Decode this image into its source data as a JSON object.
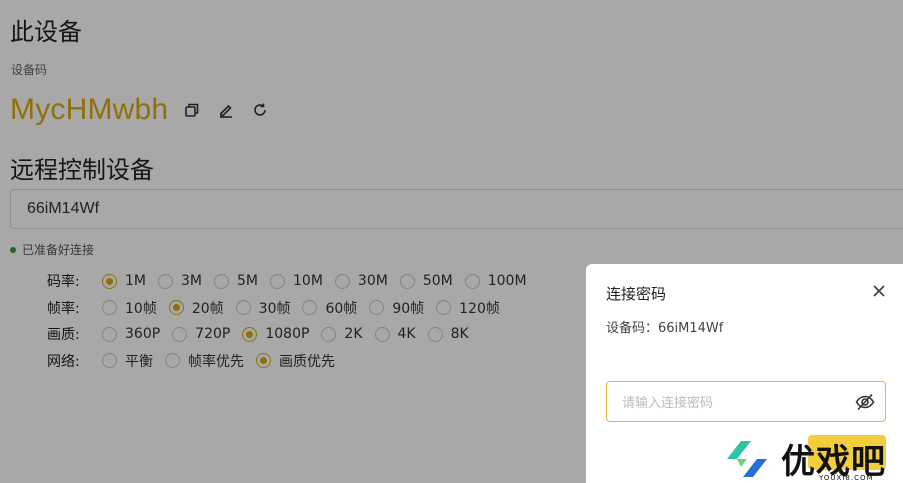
{
  "page": {
    "title": "此设备",
    "device_code_label": "设备码",
    "device_code": "MycHMwbh"
  },
  "remote": {
    "title": "远程控制设备",
    "input_value": "66iM14Wf",
    "status": "已准备好连接",
    "status_color": "#3c9a3c"
  },
  "options": {
    "bitrate": {
      "label": "码率:",
      "items": [
        "1M",
        "3M",
        "5M",
        "10M",
        "30M",
        "50M",
        "100M"
      ],
      "selected": "1M"
    },
    "framerate": {
      "label": "帧率:",
      "items": [
        "10帧",
        "20帧",
        "30帧",
        "60帧",
        "90帧",
        "120帧"
      ],
      "selected": "20帧"
    },
    "quality": {
      "label": "画质:",
      "items": [
        "360P",
        "720P",
        "1080P",
        "2K",
        "4K",
        "8K"
      ],
      "selected": "1080P"
    },
    "network": {
      "label": "网络:",
      "items": [
        "平衡",
        "帧率优先",
        "画质优先"
      ],
      "selected": "画质优先"
    }
  },
  "modal": {
    "title": "连接密码",
    "device_code_text": "设备码：66iM14Wf",
    "password_placeholder": "请输入连接密码"
  },
  "watermark": {
    "text": "优戏吧",
    "sub": "YOUXI8.COM"
  },
  "colors": {
    "accent": "#d9ab0f",
    "confirm_button": "#f3cd3d"
  },
  "icons": [
    "copy-icon",
    "edit-icon",
    "refresh-icon",
    "close-icon",
    "eye-off-icon"
  ]
}
